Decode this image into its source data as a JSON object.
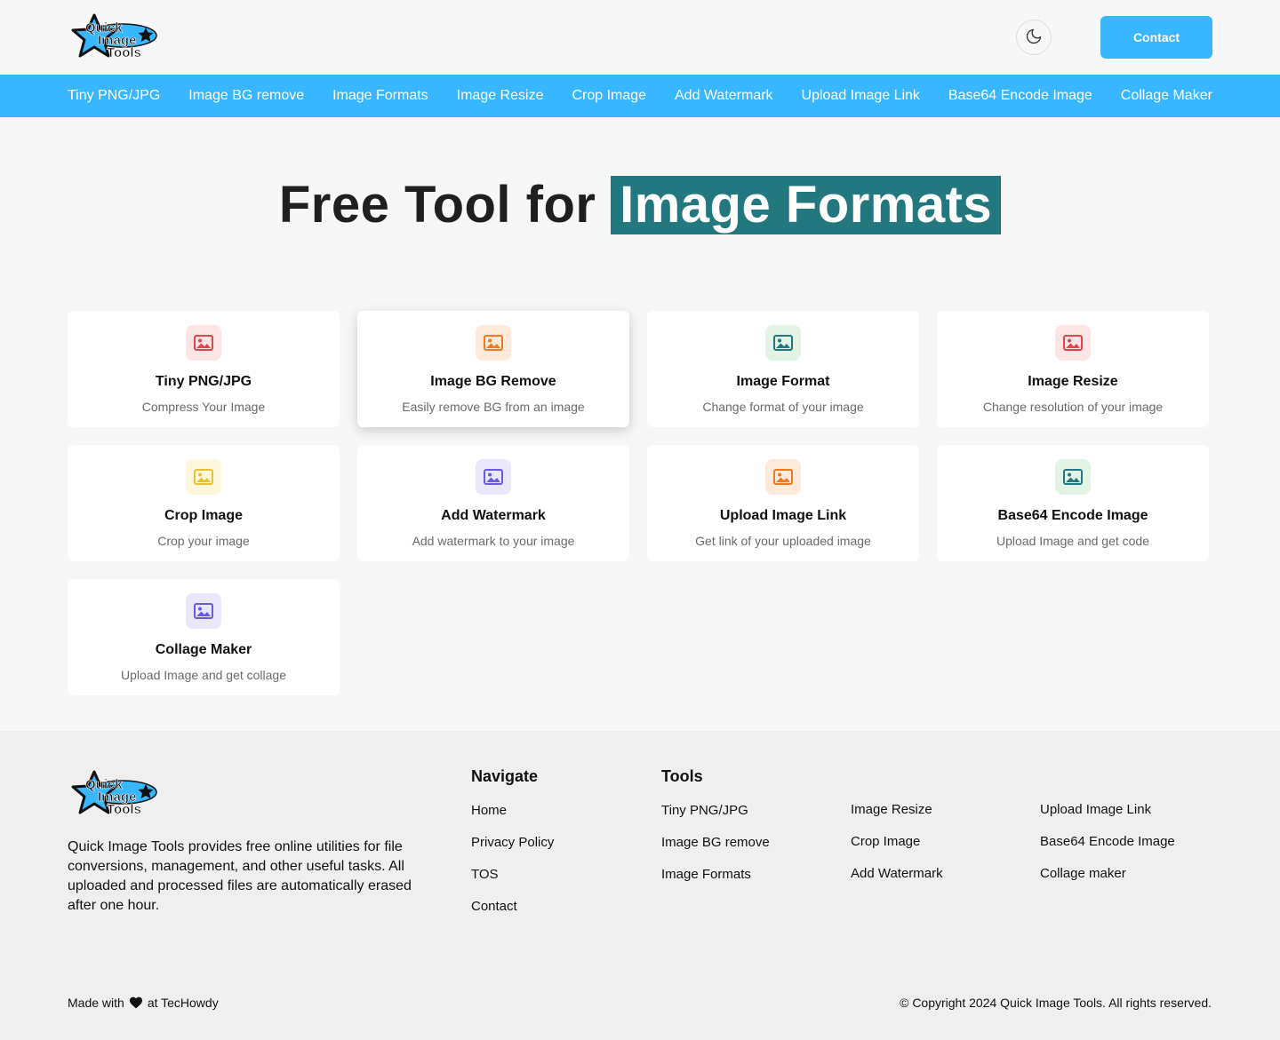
{
  "brand": {
    "logo_line1": "Quick",
    "logo_line2": "Image",
    "logo_line3": "Tools"
  },
  "header": {
    "contact_label": "Contact",
    "theme_icon": "moon-icon"
  },
  "nav": [
    "Tiny PNG/JPG",
    "Image BG remove",
    "Image Formats",
    "Image Resize",
    "Crop Image",
    "Add Watermark",
    "Upload Image Link",
    "Base64 Encode Image",
    "Collage Maker"
  ],
  "hero": {
    "prefix": "Free Tool for",
    "highlight": "Image Formats"
  },
  "cards": [
    {
      "title": "Tiny PNG/JPG",
      "desc": "Compress Your Image",
      "icon": "image-icon",
      "color": "#e0474c",
      "bg": "#fde5e5"
    },
    {
      "title": "Image BG Remove",
      "desc": "Easily remove BG from an image",
      "icon": "image-icon",
      "color": "#f07a22",
      "bg": "#fdeadb"
    },
    {
      "title": "Image Format",
      "desc": "Change format of your image",
      "icon": "image-icon",
      "color": "#237880",
      "bg": "#e3f3e5"
    },
    {
      "title": "Image Resize",
      "desc": "Change resolution of your image",
      "icon": "image-icon",
      "color": "#e0474c",
      "bg": "#fde5e5"
    },
    {
      "title": "Crop Image",
      "desc": "Crop your image",
      "icon": "image-icon",
      "color": "#e6c135",
      "bg": "#fdf8dc"
    },
    {
      "title": "Add Watermark",
      "desc": "Add watermark to your image",
      "icon": "image-icon",
      "color": "#6a5ae0",
      "bg": "#ebe7fb"
    },
    {
      "title": "Upload Image Link",
      "desc": "Get link of your uploaded image",
      "icon": "image-icon",
      "color": "#f07a22",
      "bg": "#fdeadb"
    },
    {
      "title": "Base64 Encode Image",
      "desc": "Upload Image and get code",
      "icon": "image-icon",
      "color": "#237880",
      "bg": "#e3f3e5"
    },
    {
      "title": "Collage Maker",
      "desc": "Upload Image and get collage",
      "icon": "image-icon",
      "color": "#6a5ae0",
      "bg": "#ebe7fb"
    }
  ],
  "footer": {
    "about": "Quick Image Tools provides free online utilities for file conversions, management, and other useful tasks. All uploaded and processed files are automatically erased after one hour.",
    "navigate_title": "Navigate",
    "navigate": [
      "Home",
      "Privacy Policy",
      "TOS",
      "Contact"
    ],
    "tools_title": "Tools",
    "tools_col1": [
      "Tiny PNG/JPG",
      "Image BG remove",
      "Image Formats"
    ],
    "tools_col2": [
      "Image Resize",
      "Crop Image",
      "Add Watermark"
    ],
    "tools_col3": [
      "Upload Image Link",
      "Base64 Encode Image",
      "Collage maker"
    ],
    "made_prefix": "Made with",
    "made_suffix": "at TecHowdy",
    "copyright": "© Copyright 2024 Quick Image Tools. All rights reserved."
  },
  "colors": {
    "accent": "#38b6ff",
    "highlight": "#237880"
  }
}
